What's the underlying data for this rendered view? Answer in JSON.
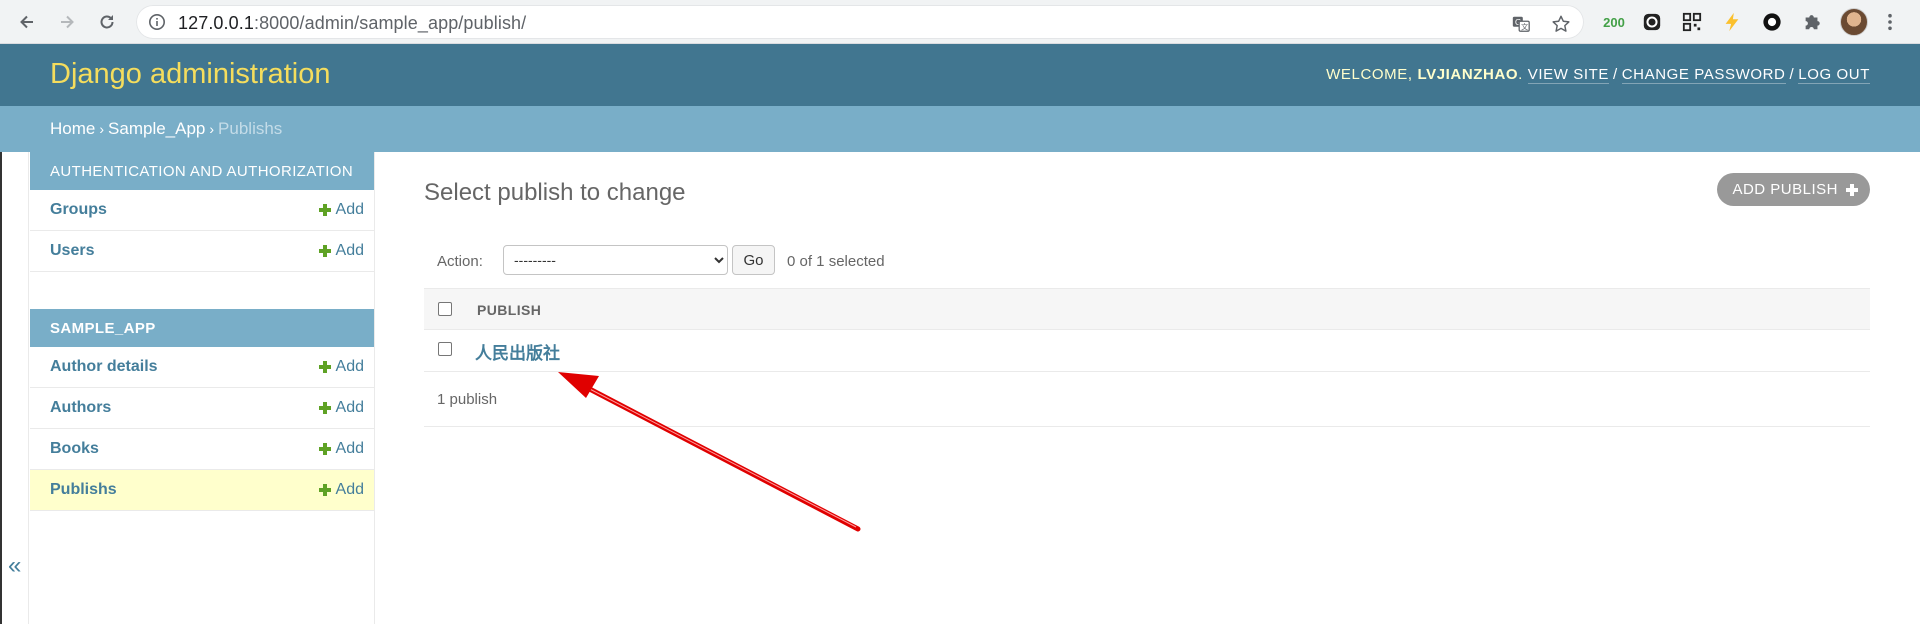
{
  "browser": {
    "url_host": "127.0.0.1",
    "url_rest": ":8000/admin/sample_app/publish/",
    "extension_badge": "200",
    "icons": [
      "back-icon",
      "forward-icon",
      "reload-icon",
      "info-icon",
      "translate-icon",
      "star-icon",
      "extension-icon",
      "profile-avatar"
    ]
  },
  "header": {
    "branding": "Django administration",
    "welcome": "Welcome,",
    "username": "lvjianzhao",
    "view_site": "View site",
    "change_password": "Change password",
    "log_out": "Log out",
    "sep": "/"
  },
  "breadcrumbs": {
    "home": "Home",
    "app": "Sample_App",
    "current": "Publishs",
    "sep": "›"
  },
  "sidebar": {
    "collapse": "«",
    "modules": [
      {
        "caption": "Authentication and Authorization",
        "models": [
          {
            "name": "Groups",
            "add": "Add"
          },
          {
            "name": "Users",
            "add": "Add"
          }
        ]
      },
      {
        "caption": "Sample_App",
        "models": [
          {
            "name": "Author details",
            "add": "Add"
          },
          {
            "name": "Authors",
            "add": "Add"
          },
          {
            "name": "Books",
            "add": "Add"
          },
          {
            "name": "Publishs",
            "add": "Add"
          }
        ]
      }
    ]
  },
  "content": {
    "title": "Select publish to change",
    "add_button": "Add publish",
    "action_label": "Action:",
    "action_selected": "---------",
    "go": "Go",
    "selection_counter": "0 of 1 selected",
    "column_header": "Publish",
    "rows": [
      "人民出版社"
    ],
    "paginator": "1 publish"
  },
  "colors": {
    "header_bg": "#417690",
    "breadcrumb_bg": "#79aec8",
    "branding": "#f5dd5d",
    "link": "#447e9b",
    "add_plus": "#5fa225",
    "active_row": "#ffffcc",
    "annotation_arrow": "#e00000"
  }
}
